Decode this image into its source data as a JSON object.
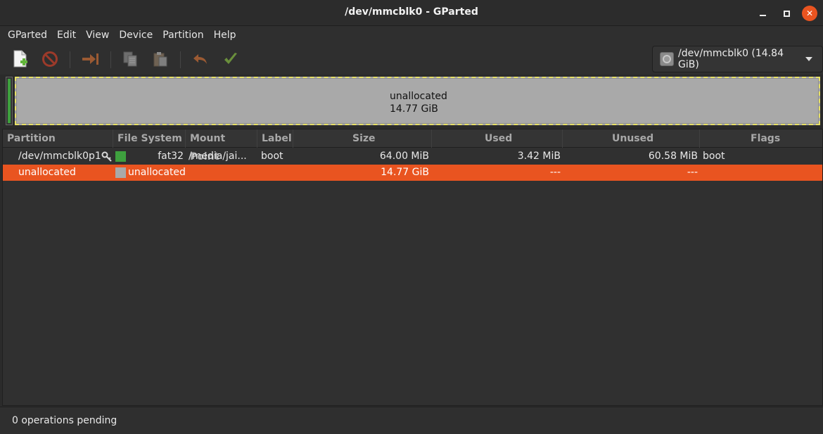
{
  "window": {
    "title": "/dev/mmcblk0 - GParted"
  },
  "menubar": {
    "items": [
      "GParted",
      "Edit",
      "View",
      "Device",
      "Partition",
      "Help"
    ]
  },
  "toolbar": {
    "buttons": [
      "new-partition",
      "delete-partition",
      "resize-move",
      "copy",
      "paste",
      "undo",
      "apply"
    ],
    "device_selector": "/dev/mmcblk0 (14.84 GiB)"
  },
  "diskmap": {
    "unallocated_label": "unallocated",
    "unallocated_size": "14.77 GiB",
    "colors": {
      "boot": "#3ea03e",
      "unallocated": "#a9a9a9",
      "border": "#e6e066"
    }
  },
  "table": {
    "columns": [
      "Partition",
      "File System",
      "Mount Point",
      "Label",
      "Size",
      "Used",
      "Unused",
      "Flags"
    ],
    "rows": [
      {
        "partition": "/dev/mmcblk0p1",
        "filesystem": "fat32",
        "fs_color": "#3ea03e",
        "mount_point": "/media/jai...",
        "label": "boot",
        "size": "64.00 MiB",
        "used": "3.42 MiB",
        "unused": "60.58 MiB",
        "flags": "boot"
      },
      {
        "partition": "unallocated",
        "filesystem": "unallocated",
        "fs_color": "#a9a9a9",
        "mount_point": "",
        "label": "",
        "size": "14.77 GiB",
        "used": "---",
        "unused": "---",
        "flags": ""
      }
    ],
    "selection_color": "#e95420"
  },
  "statusbar": {
    "text": "0 operations pending"
  }
}
